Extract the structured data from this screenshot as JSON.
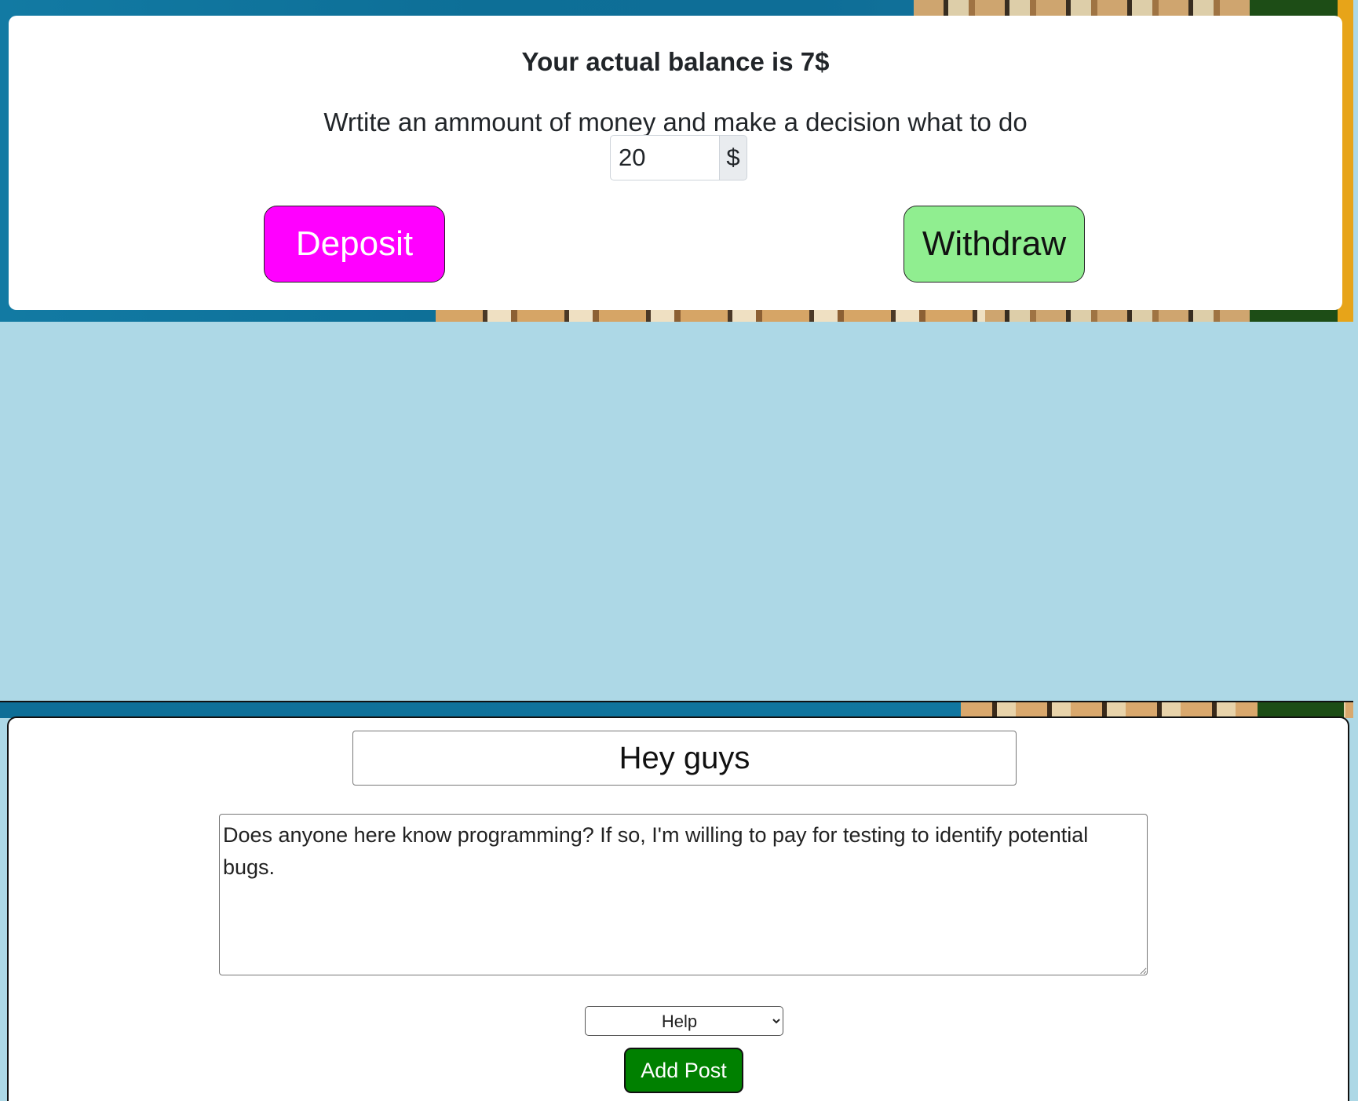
{
  "wallet": {
    "balance_text": "Your actual balance is 7$",
    "instruction": "Wrtite an ammount of money and make a decision what to do",
    "amount_value": "20",
    "currency_symbol": "$",
    "deposit_label": "Deposit",
    "withdraw_label": "Withdraw",
    "colors": {
      "deposit": "#ff00ff",
      "withdraw": "#90ee90"
    }
  },
  "post_form": {
    "title_value": "Hey guys",
    "body_value": "Does anyone here know programming? If so, I'm willing to pay for testing to identify potential bugs.",
    "category_selected": "Help",
    "submit_label": "Add Post",
    "colors": {
      "submit": "#008000",
      "page_background": "#add8e6"
    }
  }
}
